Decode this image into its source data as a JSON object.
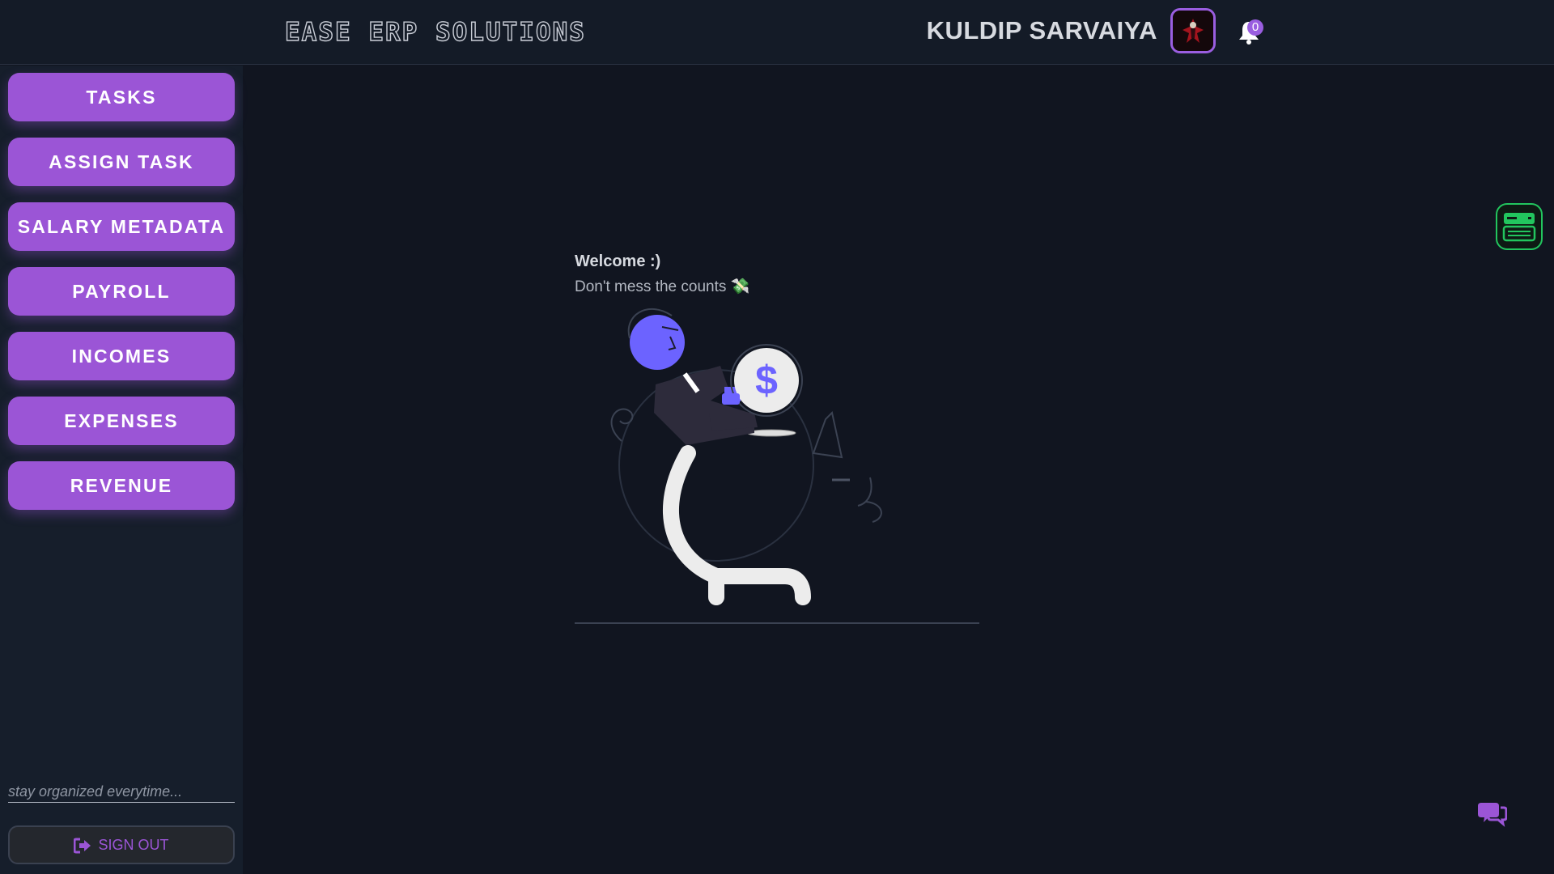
{
  "header": {
    "brand": "EASE ERP SOLUTIONS",
    "user_name": "KULDIP SARVAIYA",
    "notification_count": "0"
  },
  "sidebar": {
    "items": [
      {
        "label": "TASKS"
      },
      {
        "label": "ASSIGN TASK"
      },
      {
        "label": "SALARY METADATA"
      },
      {
        "label": "PAYROLL"
      },
      {
        "label": "INCOMES"
      },
      {
        "label": "EXPENSES"
      },
      {
        "label": "REVENUE"
      }
    ],
    "tagline": "stay organized everytime...",
    "signout_label": "SIGN OUT"
  },
  "main": {
    "welcome": "Welcome :)",
    "subtitle": "Don't mess the counts 💸"
  },
  "icons": {
    "avatar": "avatar",
    "notification": "bell-icon",
    "widget": "server-icon",
    "chat": "chat-icon",
    "signout": "signout-icon"
  },
  "colors": {
    "accent": "#9b55d6",
    "widget_green": "#22c55e",
    "illustration_blue": "#6c63ff"
  }
}
